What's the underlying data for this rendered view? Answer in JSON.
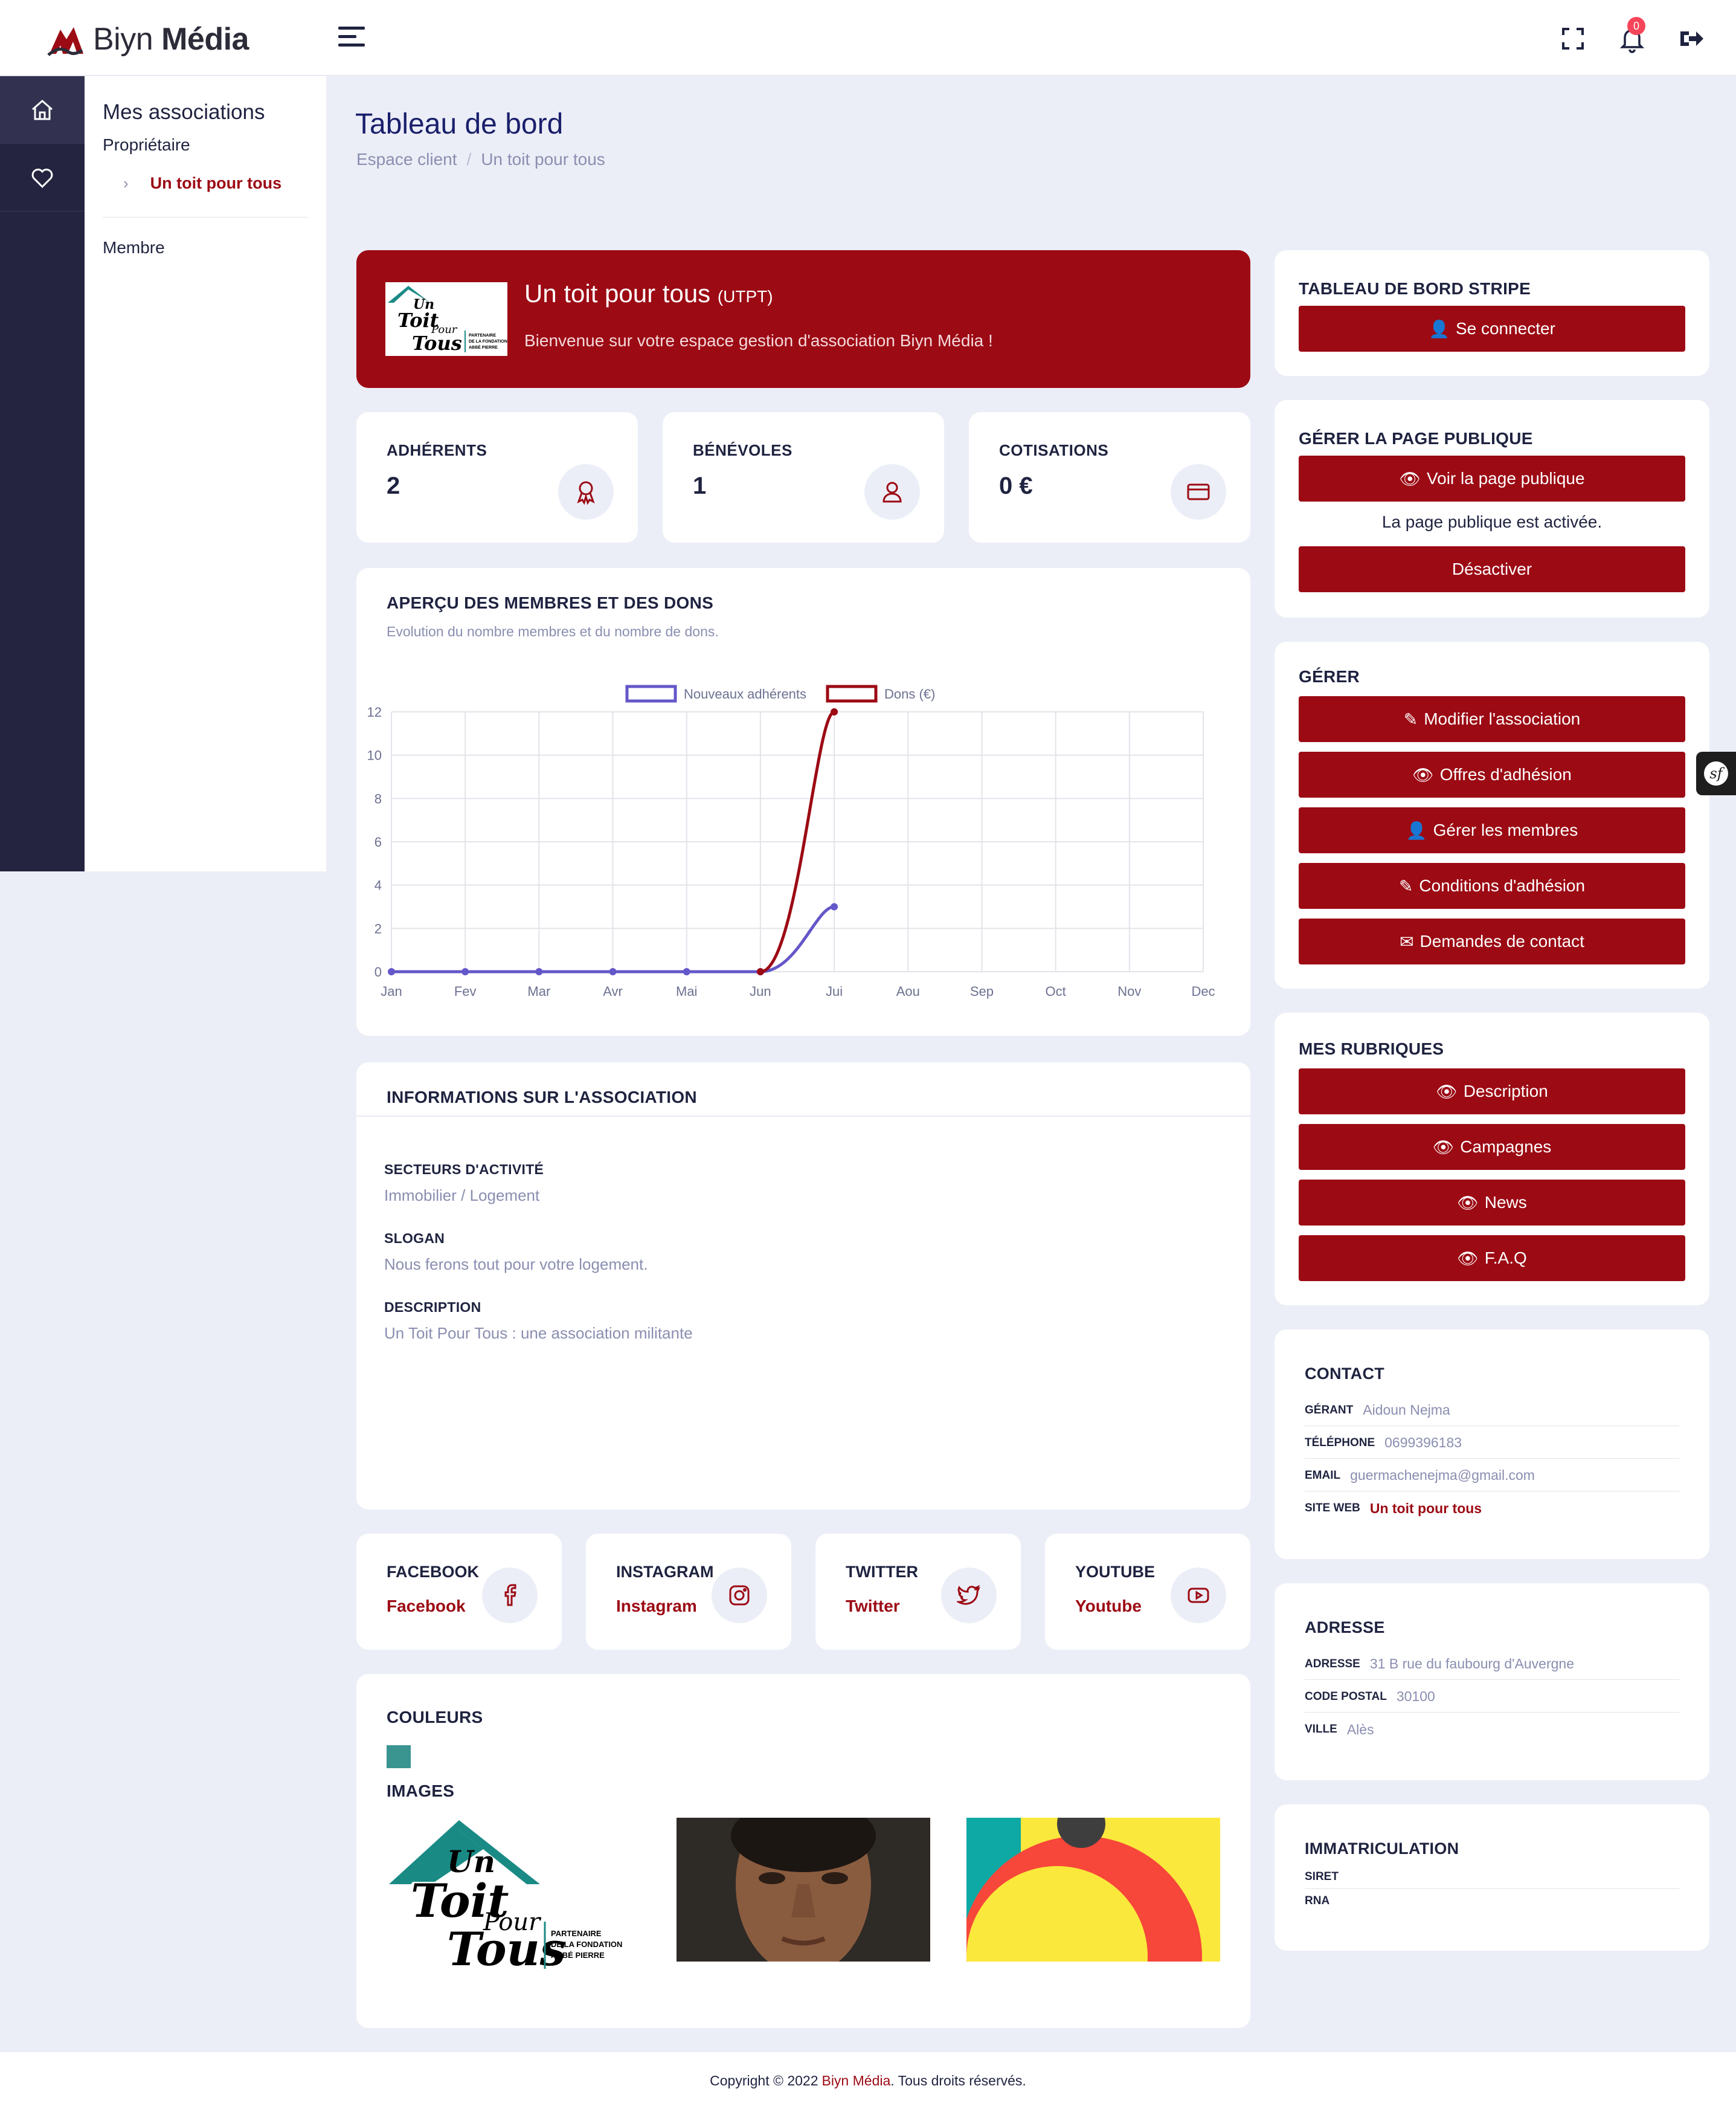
{
  "brand": {
    "name_light": "Biyn",
    "name_bold": "Média"
  },
  "header": {
    "notification_count": "0"
  },
  "sidebar": {
    "title": "Mes associations",
    "owner_label": "Propriétaire",
    "association_link": "Un toit pour tous",
    "member_label": "Membre"
  },
  "page": {
    "title": "Tableau de bord",
    "breadcrumb": [
      "Espace client",
      "/",
      "Un toit pour tous"
    ]
  },
  "hero": {
    "name": "Un toit pour tous",
    "acronym": "(UTPT)",
    "welcome": "Bienvenue sur votre espace gestion d'association Biyn Média !"
  },
  "logo_art": {
    "line1": "Un",
    "line2": "Toit",
    "line3": "Pour",
    "line4": "Tous",
    "tag1": "PARTENAIRE",
    "tag2": "DE LA FONDATION",
    "tag3": "ABBÉ PIERRE"
  },
  "stats": [
    {
      "label": "ADHÉRENTS",
      "value": "2",
      "icon": "award-icon"
    },
    {
      "label": "BÉNÉVOLES",
      "value": "1",
      "icon": "volunteer-icon"
    },
    {
      "label": "COTISATIONS",
      "value": "0 €",
      "icon": "credit-card-icon"
    }
  ],
  "chart": {
    "title": "APERÇU DES MEMBRES ET DES DONS",
    "subtitle": "Evolution du nombre membres et du nombre de dons."
  },
  "chart_data": {
    "type": "line",
    "categories": [
      "Jan",
      "Fev",
      "Mar",
      "Avr",
      "Mai",
      "Jun",
      "Jui",
      "Aou",
      "Sep",
      "Oct",
      "Nov",
      "Dec"
    ],
    "series": [
      {
        "name": "Nouveaux adhérents",
        "color": "#6457c9",
        "values": [
          0,
          0,
          0,
          0,
          0,
          0,
          3
        ]
      },
      {
        "name": "Dons (€)",
        "color": "#9c0a14",
        "values": [
          null,
          null,
          null,
          null,
          null,
          0,
          12
        ]
      }
    ],
    "yticks": [
      0,
      2,
      4,
      6,
      8,
      10,
      12
    ],
    "ylim": [
      0,
      12
    ],
    "grid": true,
    "legend_position": "top-center"
  },
  "info": {
    "title": "INFORMATIONS SUR L'ASSOCIATION",
    "sector_label": "SECTEURS D'ACTIVITÉ",
    "sector_value": "Immobilier / Logement",
    "slogan_label": "SLOGAN",
    "slogan_value": "Nous ferons tout pour votre logement.",
    "description_label": "DESCRIPTION",
    "description_value": "Un Toit Pour Tous : une association militante"
  },
  "socials": [
    {
      "label": "FACEBOOK",
      "link": "Facebook",
      "icon": "facebook-icon"
    },
    {
      "label": "INSTAGRAM",
      "link": "Instagram",
      "icon": "instagram-icon"
    },
    {
      "label": "TWITTER",
      "link": "Twitter",
      "icon": "twitter-icon"
    },
    {
      "label": "YOUTUBE",
      "link": "Youtube",
      "icon": "youtube-icon"
    }
  ],
  "media": {
    "colors_title": "COULEURS",
    "swatch_color": "#3a9490",
    "images_title": "IMAGES"
  },
  "stripe": {
    "title": "TABLEAU DE BORD STRIPE",
    "button": "Se connecter"
  },
  "public_page": {
    "title": "GÉRER LA PAGE PUBLIQUE",
    "view_button": "Voir la page publique",
    "status": "La page publique est activée.",
    "toggle_button": "Désactiver"
  },
  "manage": {
    "title": "GÉRER",
    "buttons": [
      "Modifier l'association",
      "Offres d'adhésion",
      "Gérer les membres",
      "Conditions d'adhésion",
      "Demandes de contact"
    ]
  },
  "rubriques": {
    "title": "MES RUBRIQUES",
    "buttons": [
      "Description",
      "Campagnes",
      "News",
      "F.A.Q"
    ]
  },
  "contact": {
    "title": "CONTACT",
    "manager_label": "GÉRANT",
    "manager_value": "Aidoun Nejma",
    "phone_label": "TÉLÉPHONE",
    "phone_value": "0699396183",
    "email_label": "EMAIL",
    "email_value": "guermachenejma@gmail.com",
    "website_label": "SITE WEB",
    "website_value": "Un toit pour tous"
  },
  "address": {
    "title": "ADRESSE",
    "street_label": "ADRESSE",
    "street_value": "31 B rue du faubourg d'Auvergne",
    "zip_label": "CODE POSTAL",
    "zip_value": "30100",
    "city_label": "VILLE",
    "city_value": "Alès"
  },
  "registration": {
    "title": "IMMATRICULATION",
    "siret_label": "SIRET",
    "rna_label": "RNA"
  },
  "footer": {
    "text": "Copyright © 2022",
    "brand": "Biyn Média",
    "rights": ". Tous droits réservés."
  }
}
